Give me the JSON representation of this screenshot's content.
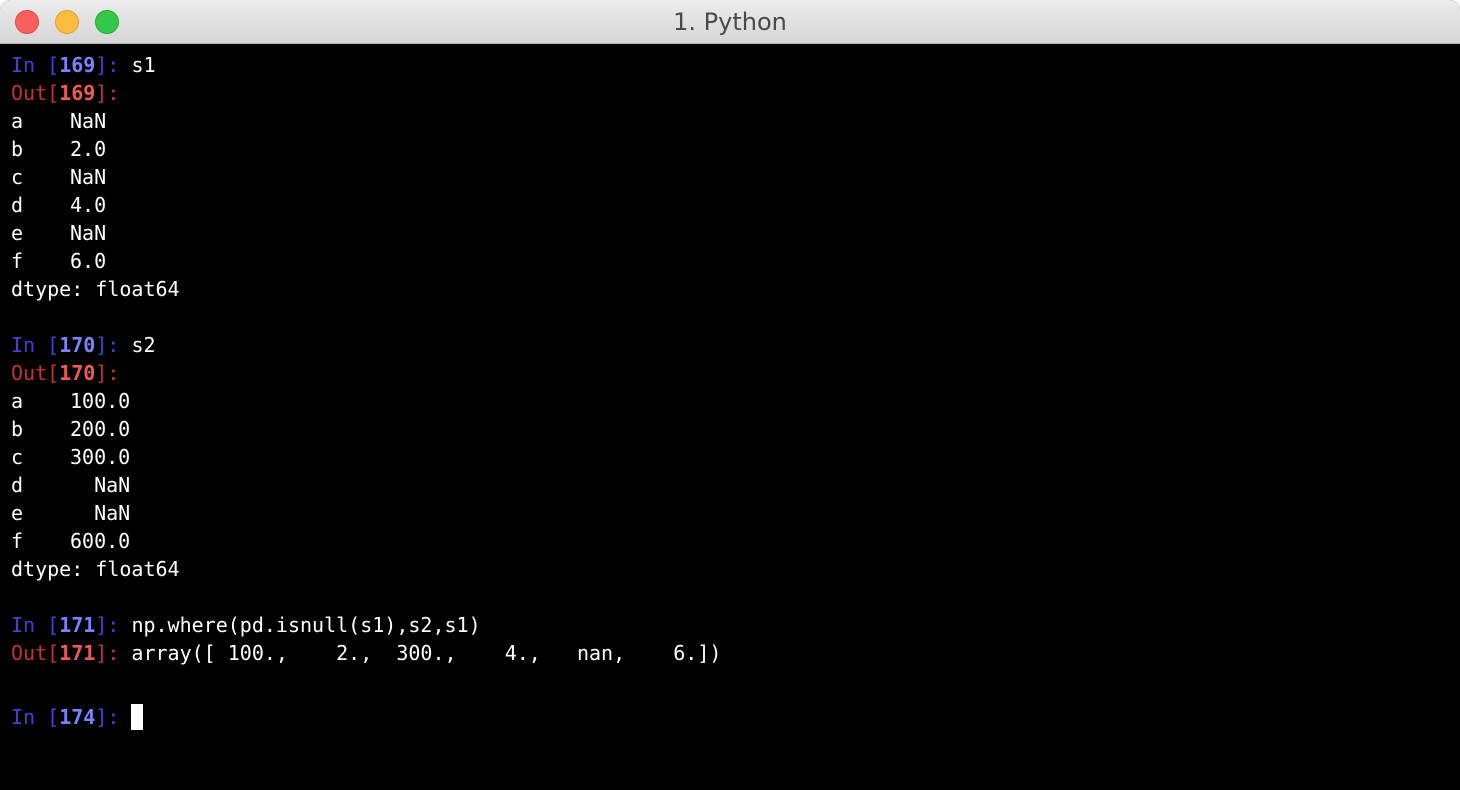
{
  "window": {
    "title": "1. Python"
  },
  "prompts": {
    "in_label": "In",
    "out_label": "Out"
  },
  "cells": [
    {
      "number": "169",
      "input": "s1",
      "output_rows": [
        {
          "index": "a",
          "value": "NaN"
        },
        {
          "index": "b",
          "value": "2.0"
        },
        {
          "index": "c",
          "value": "NaN"
        },
        {
          "index": "d",
          "value": "4.0"
        },
        {
          "index": "e",
          "value": "NaN"
        },
        {
          "index": "f",
          "value": "6.0"
        }
      ],
      "dtype": "dtype: float64"
    },
    {
      "number": "170",
      "input": "s2",
      "output_rows": [
        {
          "index": "a",
          "value": "100.0"
        },
        {
          "index": "b",
          "value": "200.0"
        },
        {
          "index": "c",
          "value": "300.0"
        },
        {
          "index": "d",
          "value": "  NaN"
        },
        {
          "index": "e",
          "value": "  NaN"
        },
        {
          "index": "f",
          "value": "600.0"
        }
      ],
      "dtype": "dtype: float64"
    },
    {
      "number": "171",
      "input": "np.where(pd.isnull(s1),s2,s1)",
      "output_inline": "array([ 100.,    2.,  300.,    4.,   nan,    6.])"
    }
  ],
  "active_prompt": {
    "number": "174"
  },
  "colors": {
    "in_prompt": "#3d44d9",
    "out_prompt": "#c4352f",
    "background": "#000000",
    "text": "#ffffff"
  }
}
